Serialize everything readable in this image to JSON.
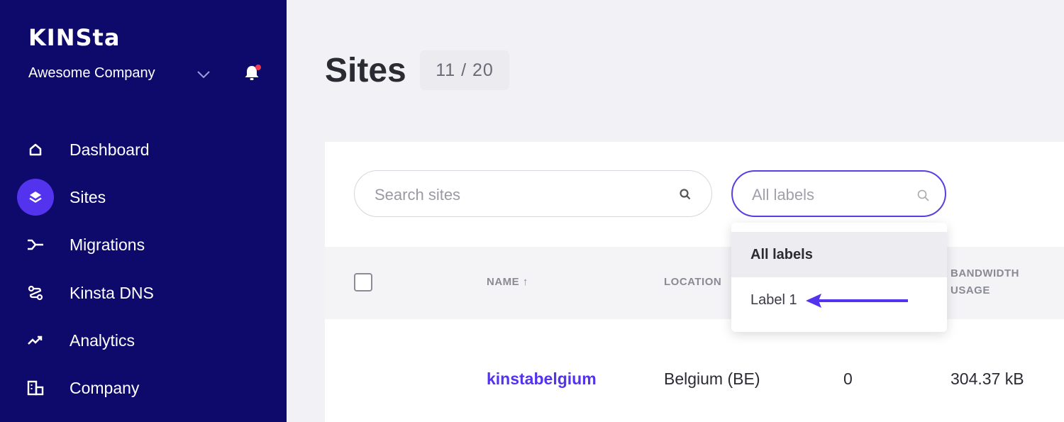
{
  "brand": {
    "logo": "KINSta",
    "accent": "#5333ed",
    "sidebar_bg": "#0e0a6b"
  },
  "company": {
    "name": "Awesome Company"
  },
  "nav": [
    {
      "label": "Dashboard",
      "icon": "home-icon",
      "active": false
    },
    {
      "label": "Sites",
      "icon": "layers-icon",
      "active": true
    },
    {
      "label": "Migrations",
      "icon": "migration-icon",
      "active": false
    },
    {
      "label": "Kinsta DNS",
      "icon": "dns-icon",
      "active": false
    },
    {
      "label": "Analytics",
      "icon": "trending-up-icon",
      "active": false
    },
    {
      "label": "Company",
      "icon": "building-icon",
      "active": false
    }
  ],
  "page": {
    "title": "Sites",
    "count": "11 / 20"
  },
  "search": {
    "placeholder": "Search sites"
  },
  "labels_filter": {
    "placeholder": "All labels",
    "options": [
      "All labels",
      "Label 1"
    ],
    "highlighted": "All labels"
  },
  "table": {
    "headers": {
      "name": "NAME ↑",
      "location": "LOCATION",
      "bandwidth_line1": "BANDWIDTH",
      "bandwidth_line2": "USAGE"
    },
    "rows": [
      {
        "name": "kinstabelgium",
        "location": "Belgium (BE)",
        "count": "0",
        "bandwidth": "304.37 kB"
      }
    ]
  }
}
